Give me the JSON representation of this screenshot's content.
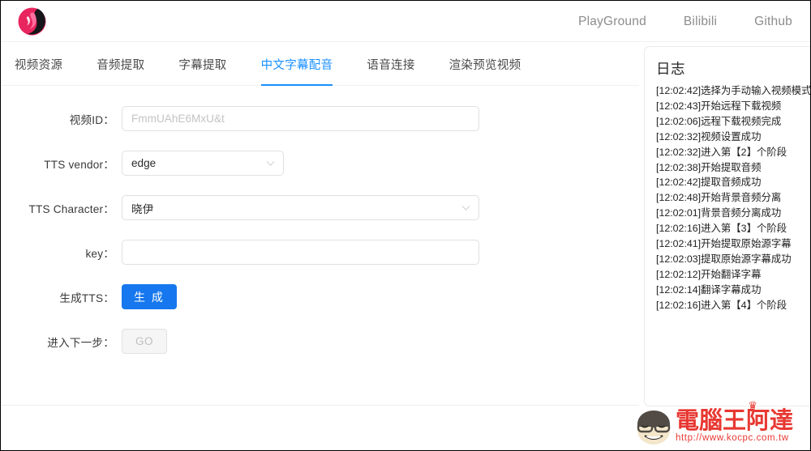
{
  "brand": {
    "logo_icon": "app-logo-icon",
    "logo_colors": {
      "circle": "#e8255f",
      "silhouette": "#1d1d1d",
      "accent": "#ff4f8b"
    }
  },
  "topnav": {
    "links": [
      {
        "label": "PlayGround",
        "name": "nav-link-playground"
      },
      {
        "label": "Bilibili",
        "name": "nav-link-bilibili"
      },
      {
        "label": "Github",
        "name": "nav-link-github"
      }
    ]
  },
  "tabs": {
    "active_index": 3,
    "items": [
      {
        "label": "视频资源"
      },
      {
        "label": "音频提取"
      },
      {
        "label": "字幕提取"
      },
      {
        "label": "中文字幕配音"
      },
      {
        "label": "语音连接"
      },
      {
        "label": "渲染预览视频"
      }
    ],
    "active_color": "#1890ff"
  },
  "form": {
    "video_id": {
      "label": "视频ID：",
      "value": "",
      "placeholder": "FmmUAhE6MxU&t"
    },
    "tts_vendor": {
      "label": "TTS vendor：",
      "value": "edge",
      "options": [
        "edge"
      ],
      "chevron_icon": "chevron-down-icon"
    },
    "tts_character": {
      "label": "TTS Character：",
      "value": "晓伊",
      "options": [
        "晓伊"
      ],
      "chevron_icon": "chevron-down-icon"
    },
    "key": {
      "label": "key：",
      "value": "",
      "placeholder": ""
    },
    "generate_tts": {
      "label": "生成TTS：",
      "button_label": "生 成",
      "button_color": "#1677ee"
    },
    "next_step": {
      "label": "进入下一步：",
      "button_label": "GO",
      "disabled": true
    }
  },
  "log": {
    "title": "日志",
    "lines": [
      "[12:02:42]选择为手动输入视频模式",
      "[12:02:43]开始远程下载视频",
      "[12:02:06]远程下载视频完成",
      "[12:02:32]视频设置成功",
      "[12:02:32]进入第【2】个阶段",
      "[12:02:38]开始提取音频",
      "[12:02:42]提取音频成功",
      "[12:02:48]开始背景音频分离",
      "[12:02:01]背景音频分离成功",
      "[12:02:16]进入第【3】个阶段",
      "[12:02:41]开始提取原始源字幕",
      "[12:02:03]提取原始源字幕成功",
      "[12:02:12]开始翻译字幕",
      "[12:02:14]翻译字幕成功",
      "[12:02:16]进入第【4】个阶段"
    ]
  },
  "watermark": {
    "brand_cn": "電腦王阿達",
    "url": "http://www.kocpc.com.tw",
    "color": "#e8322c"
  }
}
